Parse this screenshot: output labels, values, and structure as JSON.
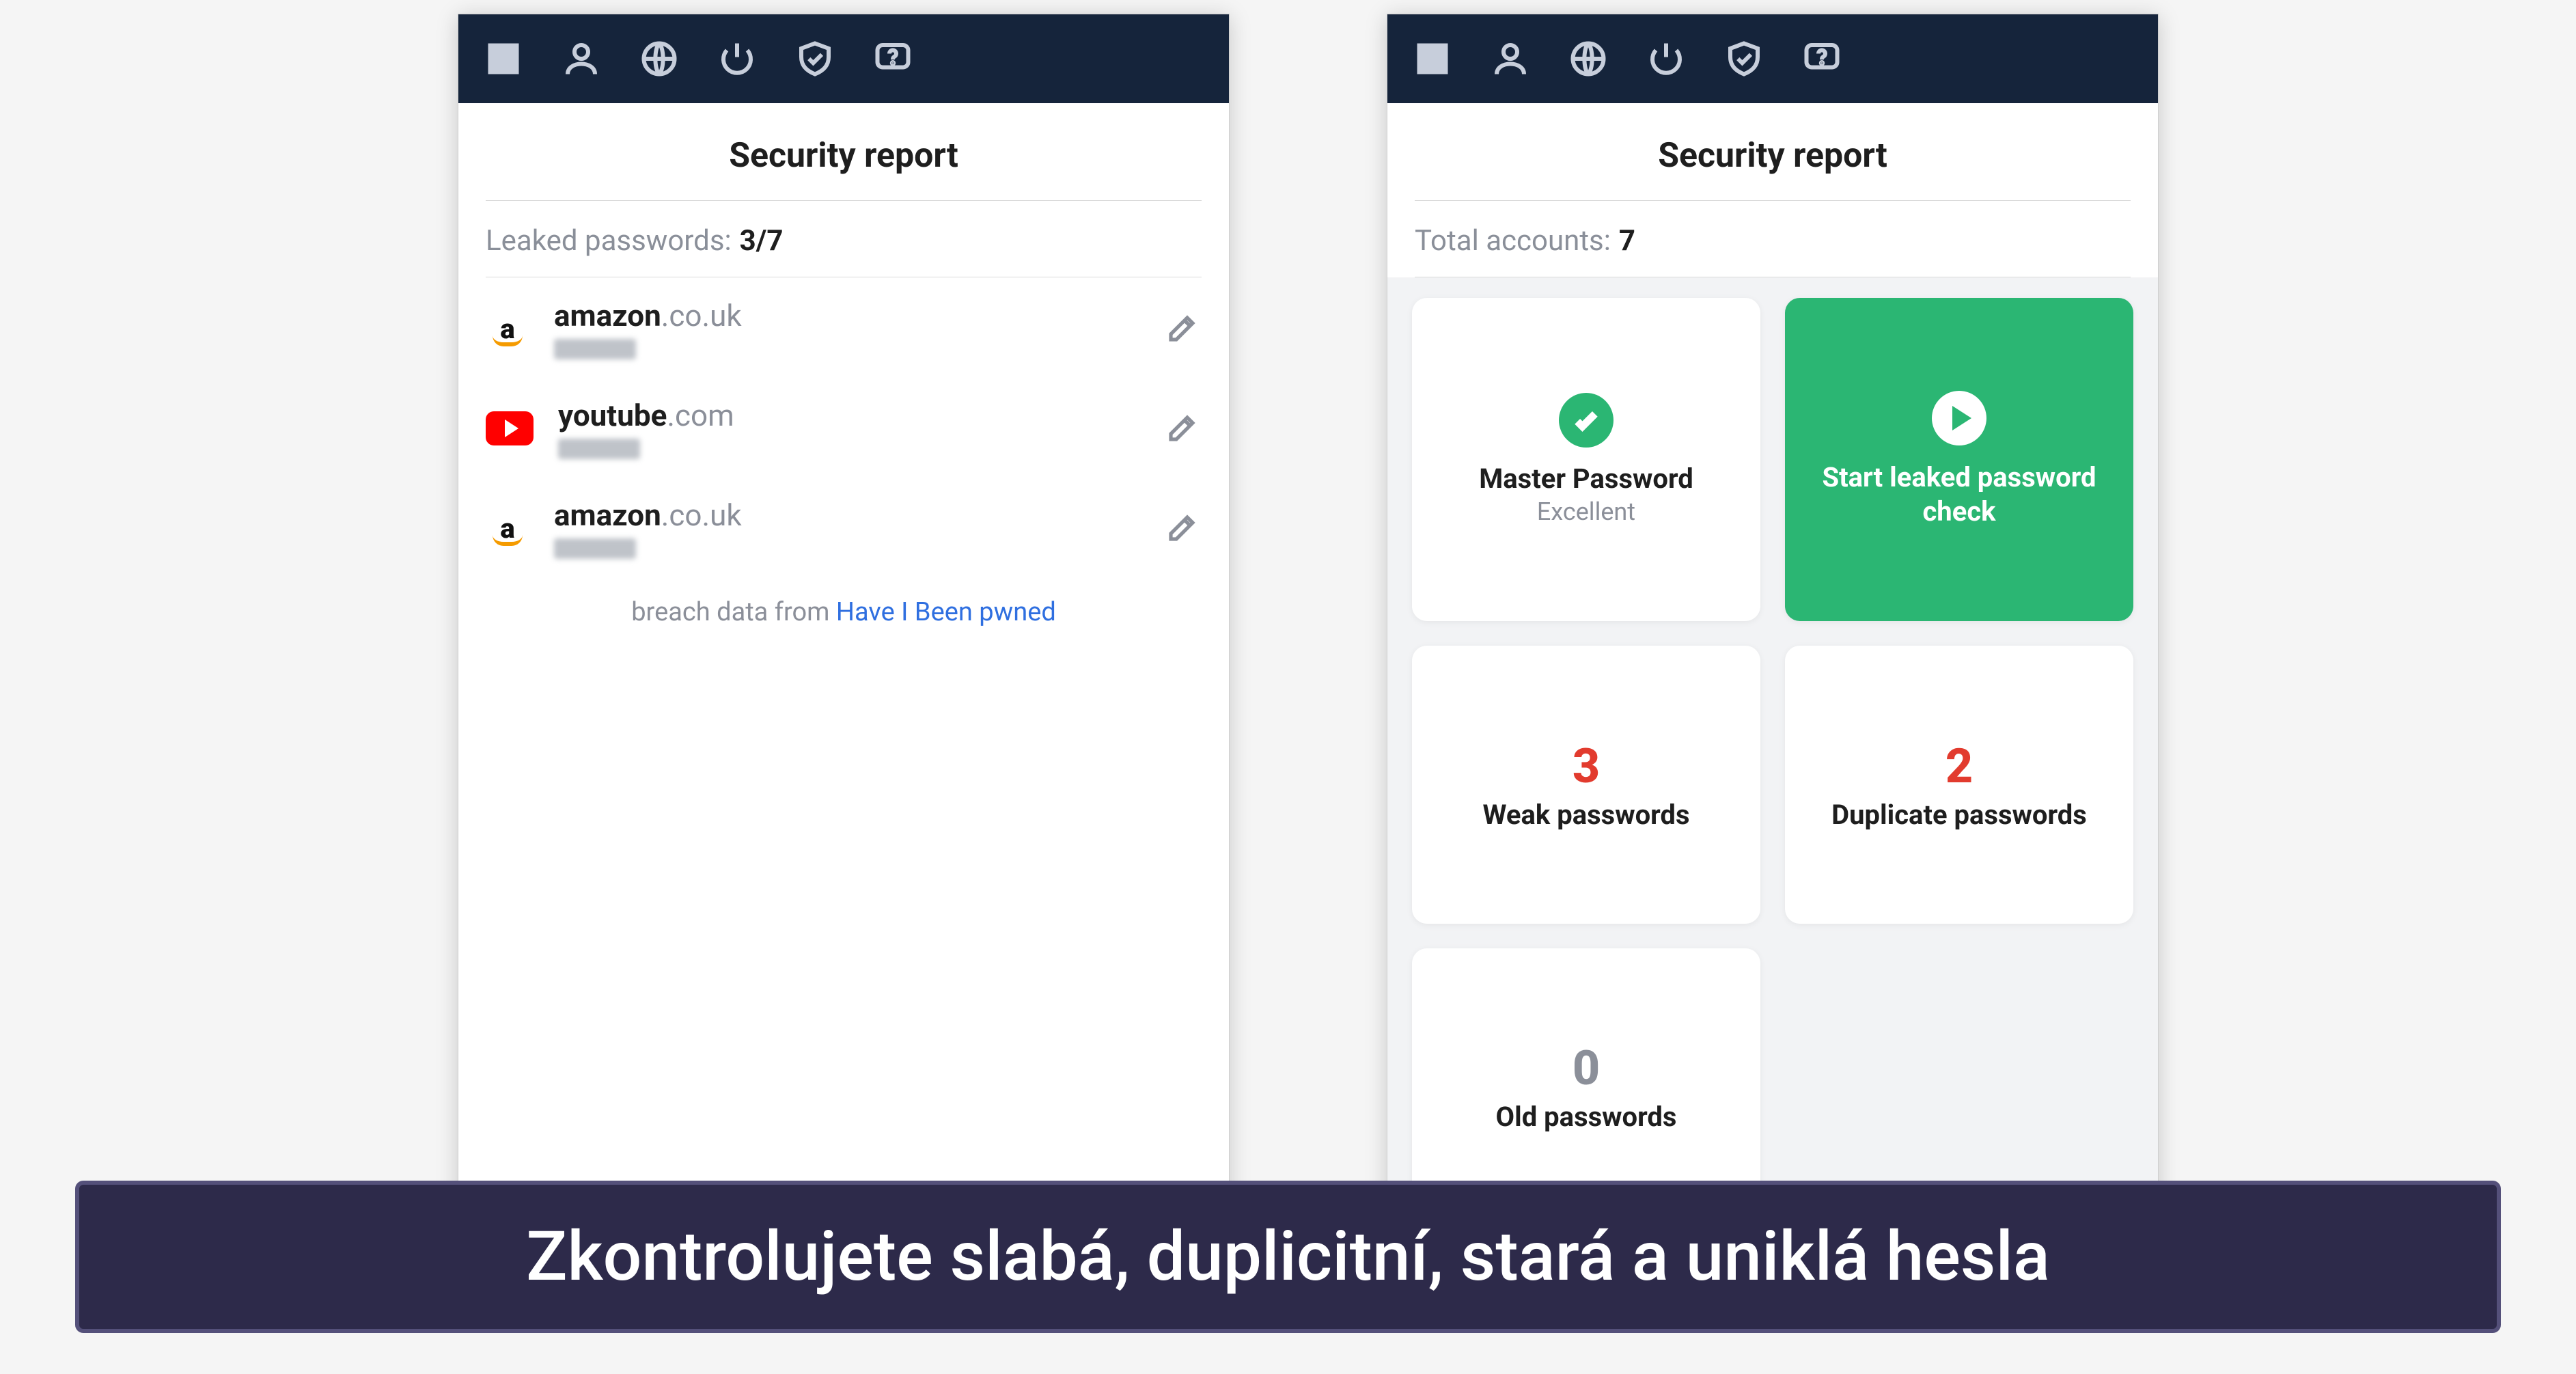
{
  "nav_icons": [
    "menu-icon",
    "profile-icon",
    "globe-icon",
    "power-icon",
    "shield-icon",
    "help-icon"
  ],
  "left": {
    "title": "Security report",
    "subhead_label": "Leaked passwords:",
    "subhead_value": "3/7",
    "items": [
      {
        "icon": "amazon",
        "domain_strong": "amazon",
        "domain_rest": ".co.uk"
      },
      {
        "icon": "youtube",
        "domain_strong": "youtube",
        "domain_rest": ".com"
      },
      {
        "icon": "amazon",
        "domain_strong": "amazon",
        "domain_rest": ".co.uk"
      }
    ],
    "credit_prefix": "breach data from ",
    "credit_link": "Have I Been pwned"
  },
  "right": {
    "title": "Security report",
    "subhead_label": "Total accounts:",
    "subhead_value": "7",
    "cards": {
      "master_title": "Master Password",
      "master_sub": "Excellent",
      "start_label": "Start leaked password check",
      "weak_count": "3",
      "weak_label": "Weak passwords",
      "dup_count": "2",
      "dup_label": "Duplicate passwords",
      "old_count": "0",
      "old_label": "Old passwords"
    }
  },
  "caption": "Zkontrolujete slabá, duplicitní, stará a uniklá hesla"
}
